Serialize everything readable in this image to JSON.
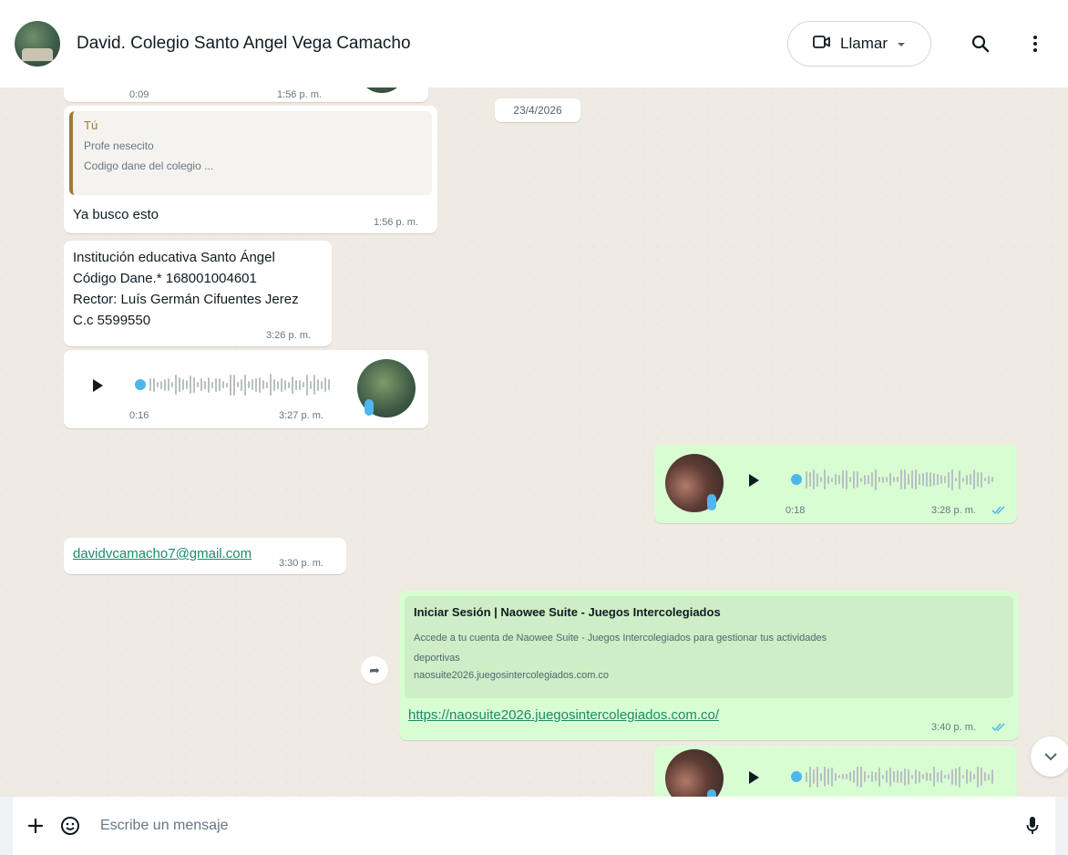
{
  "header": {
    "contact_name": "David. Colegio Santo Angel Vega Camacho",
    "call_label": "Llamar"
  },
  "chat": {
    "date_chip": "23/4/2026",
    "partial_top": {
      "duration": "0:09",
      "time": "1:56 p. m."
    },
    "reply_message": {
      "quote_author": "Tú",
      "quote_line1": "Profe nesecito",
      "quote_line2": "Codigo dane del colegio ...",
      "text": "Ya busco esto",
      "time": "1:56 p. m."
    },
    "info_message": {
      "lines": [
        "Institución educativa Santo Ángel",
        "Código Dane.* 168001004601",
        "Rector: Luís Germán Cifuentes Jerez",
        "C.c 5599550"
      ],
      "time": "3:26 p. m."
    },
    "voice_in": {
      "duration": "0:16",
      "time": "3:27 p. m."
    },
    "voice_out": {
      "duration": "0:18",
      "time": "3:28 p. m."
    },
    "email_message": {
      "text": "davidvcamacho7@gmail.com",
      "time": "3:30 p. m."
    },
    "link_message": {
      "preview_title": "Iniciar Sesión | Naowee Suite - Juegos Intercolegiados",
      "preview_desc_line1": "Accede a tu cuenta de Naowee Suite - Juegos Intercolegiados para gestionar tus actividades",
      "preview_desc_line2": "deportivas",
      "preview_domain": "naosuite2026.juegosintercolegiados.com.co",
      "url": "https://naosuite2026.juegosintercolegiados.com.co/",
      "time": "3:40 p. m."
    }
  },
  "composer": {
    "placeholder": "Escribe un mensaje"
  },
  "colors": {
    "outgoing_bubble": "#d9fdd3",
    "incoming_bubble": "#ffffff",
    "background": "#efeae2",
    "read_ticks": "#53bdeb",
    "voice_dot": "#4fb6ec"
  },
  "icons": [
    "video-call-icon",
    "chevron-down-icon",
    "search-icon",
    "menu-icon",
    "play-icon",
    "forward-icon",
    "scroll-down-icon",
    "plus-icon",
    "sticker-icon",
    "mic-icon",
    "double-check-icon"
  ]
}
